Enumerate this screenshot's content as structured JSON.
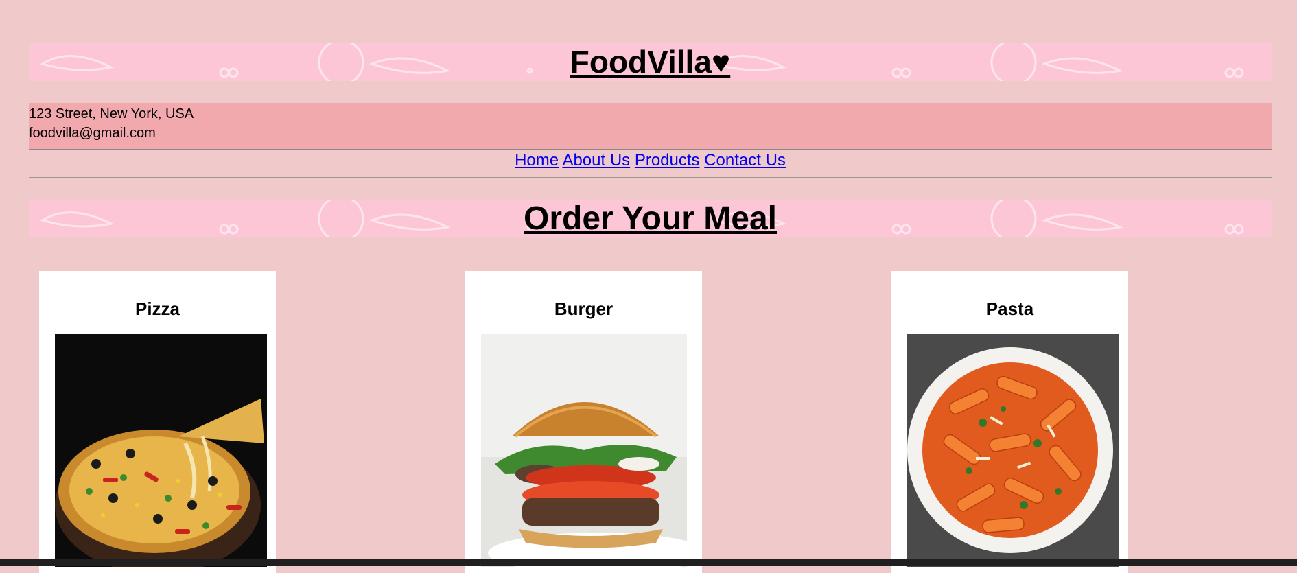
{
  "header": {
    "title": "FoodVilla♥"
  },
  "contact": {
    "address": "123 Street, New York, USA",
    "email": "foodvilla@gmail.com"
  },
  "nav": {
    "items": [
      {
        "label": "Home"
      },
      {
        "label": "About Us"
      },
      {
        "label": "Products"
      },
      {
        "label": "Contact Us"
      }
    ]
  },
  "section": {
    "title": "Order Your Meal"
  },
  "products": [
    {
      "name": "Pizza",
      "image": "pizza"
    },
    {
      "name": "Burger",
      "image": "burger"
    },
    {
      "name": "Pasta",
      "image": "pasta"
    }
  ],
  "colors": {
    "page_bg": "#f0cacb",
    "banner_bg": "#fdc6d7",
    "contact_bg": "#f2a9ae",
    "link": "#0000ee"
  }
}
